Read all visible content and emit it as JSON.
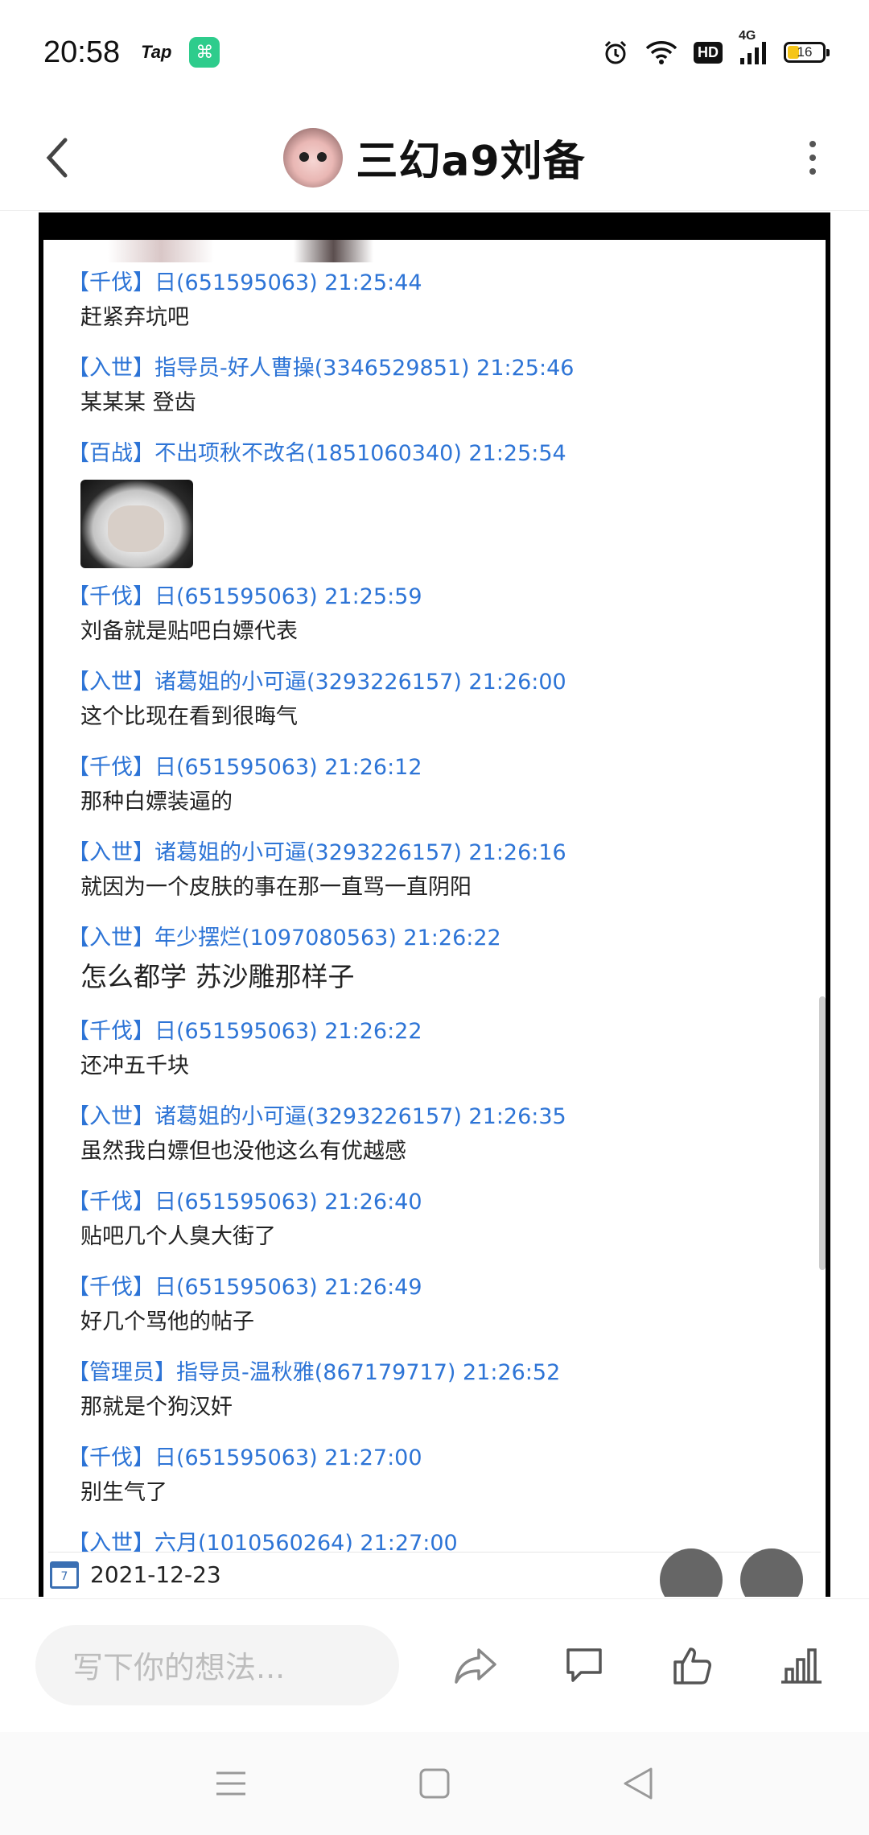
{
  "status_bar": {
    "time": "20:58",
    "tap_label": "Tap",
    "network": "4G",
    "hd_badge": "HD",
    "battery": "16"
  },
  "header": {
    "title": "三幻a9刘备"
  },
  "screenshot": {
    "messages": [
      {
        "header": "【千伐】日(651595063) 21:25:44",
        "body": "赶紧弃坑吧"
      },
      {
        "header": "【入世】指导员-好人曹操(3346529851) 21:25:46",
        "body": "某某某 登齿"
      },
      {
        "header": "【百战】不出项秋不改名(1851060340) 21:25:54",
        "body": ""
      },
      {
        "header": "【千伐】日(651595063) 21:25:59",
        "body": "刘备就是贴吧白嫖代表"
      },
      {
        "header": "【入世】诸葛姐的小可逼(3293226157) 21:26:00",
        "body": "这个比现在看到很晦气"
      },
      {
        "header": "【千伐】日(651595063) 21:26:12",
        "body": "那种白嫖装逼的"
      },
      {
        "header": "【入世】诸葛姐的小可逼(3293226157) 21:26:16",
        "body": "就因为一个皮肤的事在那一直骂一直阴阳"
      },
      {
        "header": "【入世】年少摆烂(1097080563) 21:26:22",
        "body": "怎么都学 苏沙雕那样子"
      },
      {
        "header": "【千伐】日(651595063) 21:26:22",
        "body": "还冲五千块"
      },
      {
        "header": "【入世】诸葛姐的小可逼(3293226157) 21:26:35",
        "body": "虽然我白嫖但也没他这么有优越感"
      },
      {
        "header": "【千伐】日(651595063) 21:26:40",
        "body": "贴吧几个人臭大街了"
      },
      {
        "header": "【千伐】日(651595063) 21:26:49",
        "body": "好几个骂他的帖子"
      },
      {
        "header": "【管理员】指导员-温秋雅(867179717) 21:26:52",
        "body": "那就是个狗汉奸"
      },
      {
        "header": "【千伐】日(651595063) 21:27:00",
        "body": "别生气了"
      },
      {
        "header": "【入世】六月(1010560264) 21:27:00",
        "body": ""
      }
    ],
    "date": "2021-12-23"
  },
  "bottom_bar": {
    "placeholder": "写下你的想法..."
  }
}
